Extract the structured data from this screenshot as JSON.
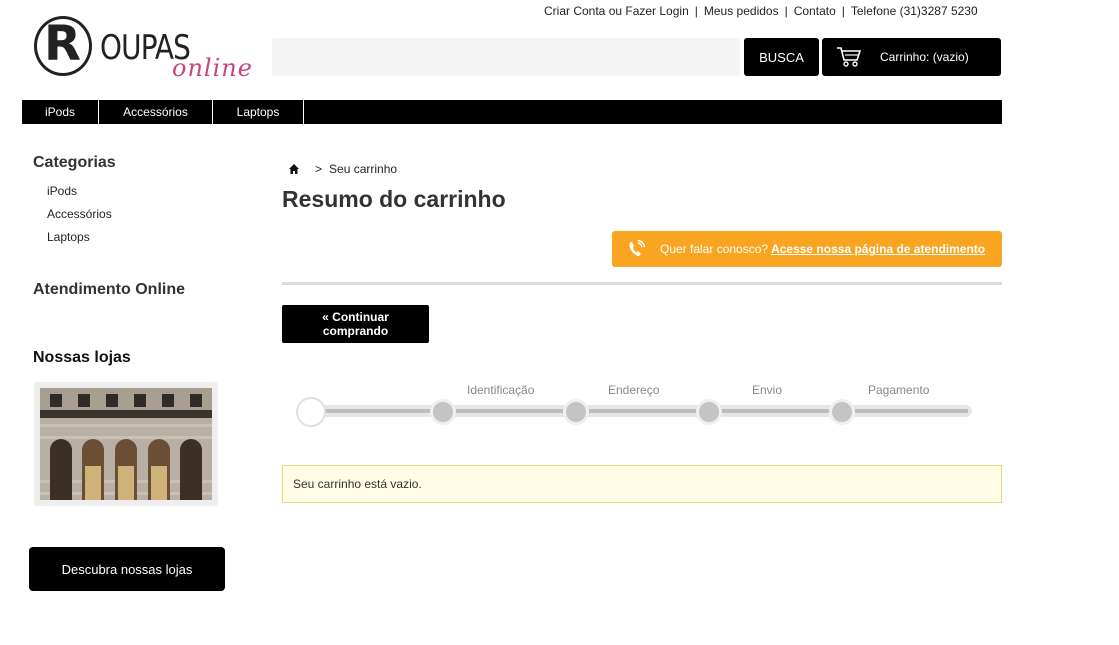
{
  "header": {
    "links": [
      "Criar Conta ou Fazer Login",
      "Meus pedidos",
      "Contato",
      "Telefone (31)3287 5230"
    ],
    "logo": {
      "letter": "R",
      "word": "OUPAS",
      "script": "online"
    },
    "search": {
      "placeholder": "",
      "button_label": "BUSCA"
    },
    "cart": {
      "label": "Carrinho: (vazio)",
      "icon": "shopping-cart-icon"
    }
  },
  "nav": {
    "items": [
      {
        "label": "iPods"
      },
      {
        "label": "Accessórios"
      },
      {
        "label": "Laptops"
      }
    ]
  },
  "sidebar": {
    "categories_title": "Categorias",
    "categories": [
      "iPods",
      "Accessórios",
      "Laptops"
    ],
    "support_title": "Atendimento Online",
    "stores_title": "Nossas lojas",
    "stores_button": "Descubra nossas lojas"
  },
  "main": {
    "breadcrumb": {
      "separator": ">",
      "current": "Seu carrinho",
      "home_icon": "home-icon"
    },
    "title": "Resumo do carrinho",
    "contact": {
      "text": "Quer falar conosco?",
      "link": "Acesse nossa página de atendimento",
      "icon": "phone-icon"
    },
    "continue_button": "« Continuar comprando",
    "steps": [
      "Identificação",
      "Endereço",
      "Envio",
      "Pagamento"
    ],
    "empty_message": "Seu carrinho está vazio."
  },
  "colors": {
    "primary": "#000000",
    "accent_orange": "#f9a521",
    "logo_pink": "#c4477d",
    "notice_bg": "#fffde6",
    "notice_border": "#e5d87a"
  }
}
